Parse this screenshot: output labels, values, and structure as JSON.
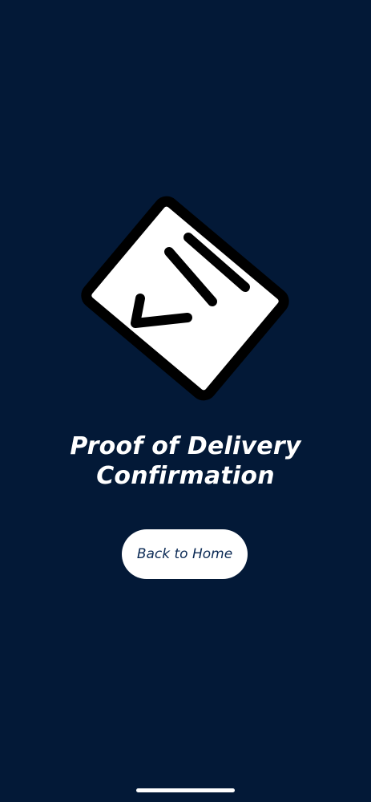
{
  "title": {
    "line1": "Proof of Delivery",
    "line2": "Confirmation"
  },
  "back_button_label": "Back to Home",
  "illustration_icon": "delivery-receipt-check-icon",
  "colors": {
    "background": "#031937",
    "button_bg": "#ffffff",
    "button_text": "#0b2a55",
    "title_text": "#ffffff"
  }
}
